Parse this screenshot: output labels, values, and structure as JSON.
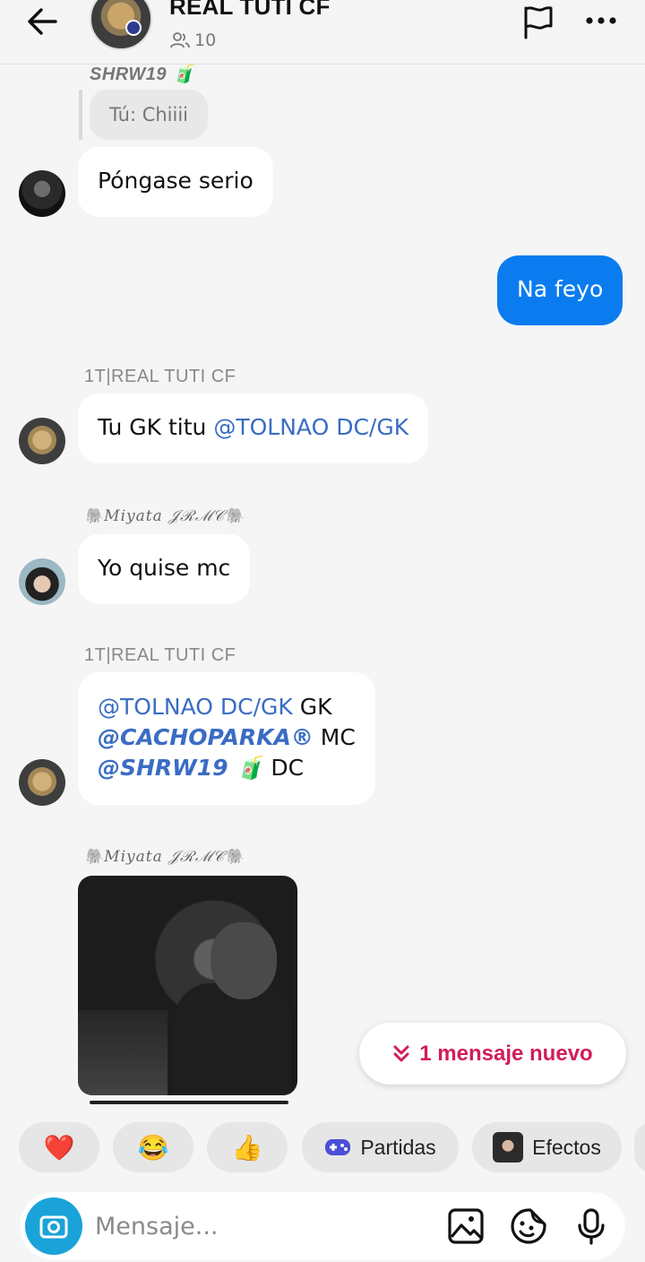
{
  "header": {
    "title": "REAL TUTI CF",
    "member_count": "10"
  },
  "messages": {
    "reply_sender": "SHRW19 🧃",
    "reply_text": "Tú: Chiiii",
    "m1_text": "Póngase serio",
    "m2_text": "Na feyo",
    "m3_sender": "1T|REAL TUTI CF",
    "m3_prefix": "Tu GK titu ",
    "m3_mention": "@TOLNAO DC/GK",
    "m4_sender": "🐘Miyata 𝒥ℛℳ𝒞🐘",
    "m4_text": "Yo quise mc",
    "m5_sender": "1T|REAL TUTI CF",
    "m5_line1_mention": "@TOLNAO DC/GK",
    "m5_line1_text": " GK",
    "m5_line2_mention": "@CACHOPARKA®",
    "m5_line2_text": " MC",
    "m5_line3_mention": "@SHRW19 🧃",
    "m5_line3_text": " DC",
    "m6_sender": "🐘Miyata 𝒥ℛℳ𝒞🐘"
  },
  "new_messages_button": "1 mensaje nuevo",
  "reactions": {
    "heart": "❤️",
    "laugh": "😂",
    "thumbs": "👍",
    "games_label": "Partidas",
    "effects_label": "Efectos"
  },
  "composer": {
    "placeholder": "Mensaje..."
  },
  "colors": {
    "accent_blue": "#0a7cf0",
    "mention_blue": "#3a6cc4",
    "new_message_pink": "#d01d5b",
    "camera_blue": "#1aa3d8"
  }
}
